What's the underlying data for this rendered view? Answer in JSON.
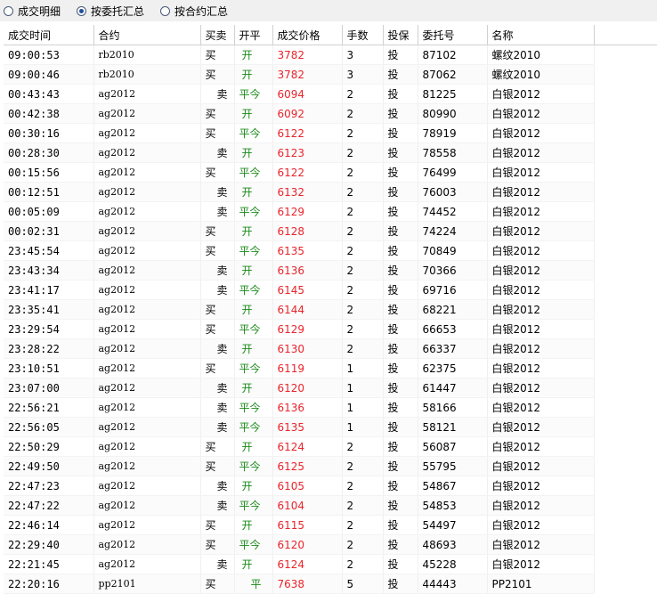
{
  "radios": [
    {
      "label": "成交明细",
      "checked": false
    },
    {
      "label": "按委托汇总",
      "checked": true
    },
    {
      "label": "按合约汇总",
      "checked": false
    }
  ],
  "columns": [
    "成交时间",
    "合约",
    "买卖",
    "开平",
    "成交价格",
    "手数",
    "投保",
    "委托号",
    "名称"
  ],
  "colors": {
    "price": "#e8242b",
    "openclose": "#1a8a1a"
  },
  "rows": [
    {
      "time": "09:00:53",
      "code": "rb2010",
      "bs": "买",
      "oc": "开",
      "price": "3782",
      "qty": "3",
      "hedge": "投",
      "order": "87102",
      "name": "螺纹2010"
    },
    {
      "time": "09:00:46",
      "code": "rb2010",
      "bs": "买",
      "oc": "开",
      "price": "3782",
      "qty": "3",
      "hedge": "投",
      "order": "87062",
      "name": "螺纹2010"
    },
    {
      "time": "00:43:43",
      "code": "ag2012",
      "bs": "卖",
      "oc": "平今",
      "price": "6094",
      "qty": "2",
      "hedge": "投",
      "order": "81225",
      "name": "白银2012"
    },
    {
      "time": "00:42:38",
      "code": "ag2012",
      "bs": "买",
      "oc": "开",
      "price": "6092",
      "qty": "2",
      "hedge": "投",
      "order": "80990",
      "name": "白银2012"
    },
    {
      "time": "00:30:16",
      "code": "ag2012",
      "bs": "买",
      "oc": "平今",
      "price": "6122",
      "qty": "2",
      "hedge": "投",
      "order": "78919",
      "name": "白银2012"
    },
    {
      "time": "00:28:30",
      "code": "ag2012",
      "bs": "卖",
      "oc": "开",
      "price": "6123",
      "qty": "2",
      "hedge": "投",
      "order": "78558",
      "name": "白银2012"
    },
    {
      "time": "00:15:56",
      "code": "ag2012",
      "bs": "买",
      "oc": "平今",
      "price": "6122",
      "qty": "2",
      "hedge": "投",
      "order": "76499",
      "name": "白银2012"
    },
    {
      "time": "00:12:51",
      "code": "ag2012",
      "bs": "卖",
      "oc": "开",
      "price": "6132",
      "qty": "2",
      "hedge": "投",
      "order": "76003",
      "name": "白银2012"
    },
    {
      "time": "00:05:09",
      "code": "ag2012",
      "bs": "卖",
      "oc": "平今",
      "price": "6129",
      "qty": "2",
      "hedge": "投",
      "order": "74452",
      "name": "白银2012"
    },
    {
      "time": "00:02:31",
      "code": "ag2012",
      "bs": "买",
      "oc": "开",
      "price": "6128",
      "qty": "2",
      "hedge": "投",
      "order": "74224",
      "name": "白银2012"
    },
    {
      "time": "23:45:54",
      "code": "ag2012",
      "bs": "买",
      "oc": "平今",
      "price": "6135",
      "qty": "2",
      "hedge": "投",
      "order": "70849",
      "name": "白银2012"
    },
    {
      "time": "23:43:34",
      "code": "ag2012",
      "bs": "卖",
      "oc": "开",
      "price": "6136",
      "qty": "2",
      "hedge": "投",
      "order": "70366",
      "name": "白银2012"
    },
    {
      "time": "23:41:17",
      "code": "ag2012",
      "bs": "卖",
      "oc": "平今",
      "price": "6145",
      "qty": "2",
      "hedge": "投",
      "order": "69716",
      "name": "白银2012"
    },
    {
      "time": "23:35:41",
      "code": "ag2012",
      "bs": "买",
      "oc": "开",
      "price": "6144",
      "qty": "2",
      "hedge": "投",
      "order": "68221",
      "name": "白银2012"
    },
    {
      "time": "23:29:54",
      "code": "ag2012",
      "bs": "买",
      "oc": "平今",
      "price": "6129",
      "qty": "2",
      "hedge": "投",
      "order": "66653",
      "name": "白银2012"
    },
    {
      "time": "23:28:22",
      "code": "ag2012",
      "bs": "卖",
      "oc": "开",
      "price": "6130",
      "qty": "2",
      "hedge": "投",
      "order": "66337",
      "name": "白银2012"
    },
    {
      "time": "23:10:51",
      "code": "ag2012",
      "bs": "买",
      "oc": "平今",
      "price": "6119",
      "qty": "1",
      "hedge": "投",
      "order": "62375",
      "name": "白银2012"
    },
    {
      "time": "23:07:00",
      "code": "ag2012",
      "bs": "卖",
      "oc": "开",
      "price": "6120",
      "qty": "1",
      "hedge": "投",
      "order": "61447",
      "name": "白银2012"
    },
    {
      "time": "22:56:21",
      "code": "ag2012",
      "bs": "卖",
      "oc": "平今",
      "price": "6136",
      "qty": "1",
      "hedge": "投",
      "order": "58166",
      "name": "白银2012"
    },
    {
      "time": "22:56:05",
      "code": "ag2012",
      "bs": "卖",
      "oc": "平今",
      "price": "6135",
      "qty": "1",
      "hedge": "投",
      "order": "58121",
      "name": "白银2012"
    },
    {
      "time": "22:50:29",
      "code": "ag2012",
      "bs": "买",
      "oc": "开",
      "price": "6124",
      "qty": "2",
      "hedge": "投",
      "order": "56087",
      "name": "白银2012"
    },
    {
      "time": "22:49:50",
      "code": "ag2012",
      "bs": "买",
      "oc": "平今",
      "price": "6125",
      "qty": "2",
      "hedge": "投",
      "order": "55795",
      "name": "白银2012"
    },
    {
      "time": "22:47:23",
      "code": "ag2012",
      "bs": "卖",
      "oc": "开",
      "price": "6105",
      "qty": "2",
      "hedge": "投",
      "order": "54867",
      "name": "白银2012"
    },
    {
      "time": "22:47:22",
      "code": "ag2012",
      "bs": "卖",
      "oc": "平今",
      "price": "6104",
      "qty": "2",
      "hedge": "投",
      "order": "54853",
      "name": "白银2012"
    },
    {
      "time": "22:46:14",
      "code": "ag2012",
      "bs": "买",
      "oc": "开",
      "price": "6115",
      "qty": "2",
      "hedge": "投",
      "order": "54497",
      "name": "白银2012"
    },
    {
      "time": "22:29:40",
      "code": "ag2012",
      "bs": "买",
      "oc": "平今",
      "price": "6120",
      "qty": "2",
      "hedge": "投",
      "order": "48693",
      "name": "白银2012"
    },
    {
      "time": "22:21:45",
      "code": "ag2012",
      "bs": "卖",
      "oc": "开",
      "price": "6124",
      "qty": "2",
      "hedge": "投",
      "order": "45228",
      "name": "白银2012"
    },
    {
      "time": "22:20:16",
      "code": "pp2101",
      "bs": "买",
      "oc": "平",
      "price": "7638",
      "qty": "5",
      "hedge": "投",
      "order": "44443",
      "name": "PP2101"
    }
  ]
}
